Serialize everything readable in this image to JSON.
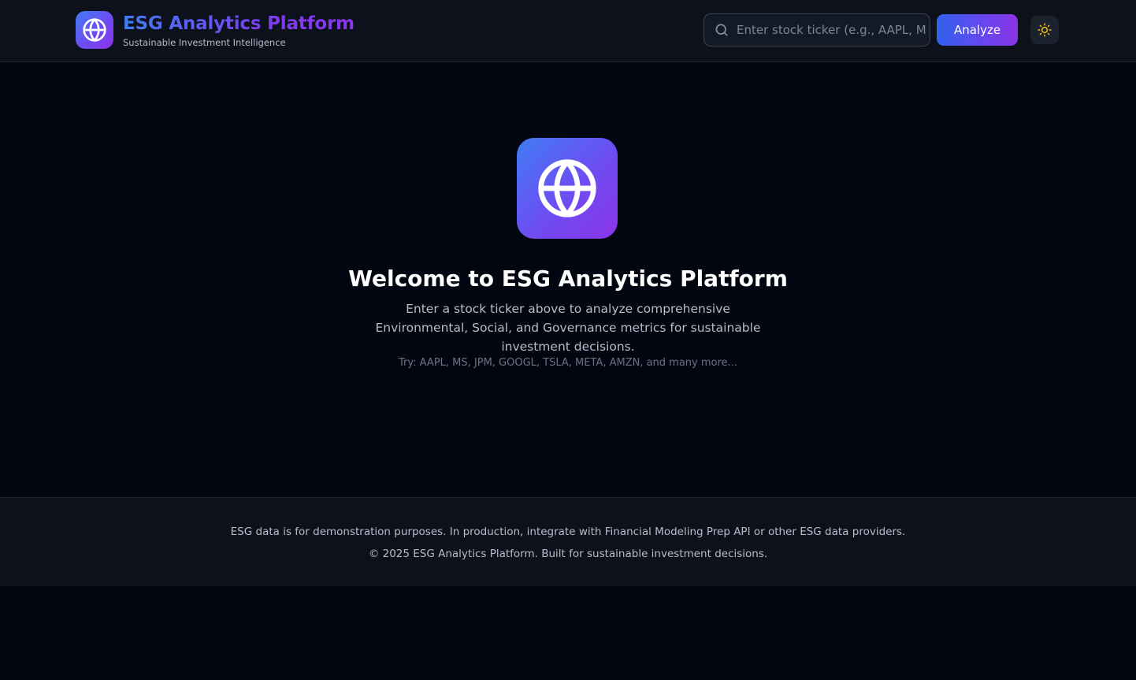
{
  "header": {
    "brand": {
      "title": "ESG Analytics Platform",
      "subtitle": "Sustainable Investment Intelligence",
      "logo_icon": "globe-icon"
    },
    "search": {
      "placeholder": "Enter stock ticker (e.g., AAPL, MS",
      "value": "",
      "icon": "search-icon"
    },
    "analyze_label": "Analyze",
    "theme_toggle_icon": "sun-icon"
  },
  "hero": {
    "icon": "globe-icon",
    "title": "Welcome to ESG Analytics Platform",
    "description": "Enter a stock ticker above to analyze comprehensive Environmental, Social, and Governance metrics for sustainable investment decisions.",
    "try_text": "Try: AAPL, MS, JPM, GOOGL, TSLA, META, AMZN, and many more..."
  },
  "footer": {
    "disclaimer": "ESG data is for demonstration purposes. In production, integrate with Financial Modeling Prep API or other ESG data providers.",
    "copyright": "© 2025 ESG Analytics Platform. Built for sustainable investment decisions."
  },
  "colors": {
    "background": "#020611",
    "header_bg": "#0c111c",
    "accent_blue": "#3f7cf4",
    "accent_purple": "#8b33e8",
    "sun": "#f5c518"
  }
}
